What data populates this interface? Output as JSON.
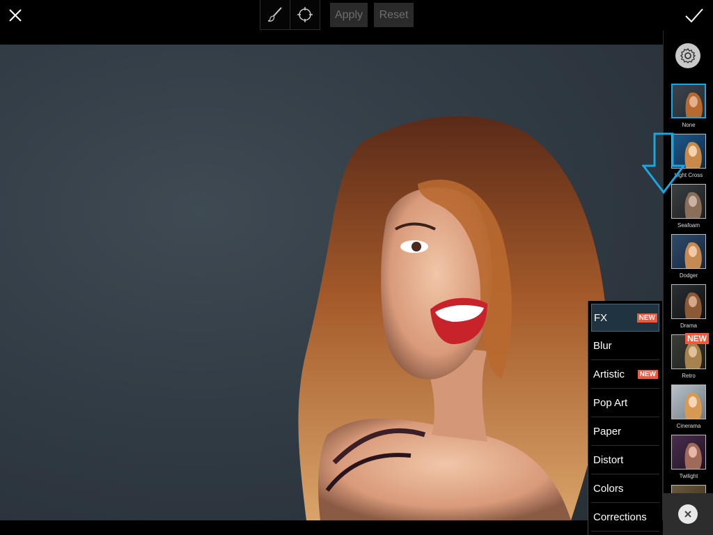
{
  "toolbar": {
    "apply_label": "Apply",
    "reset_label": "Reset",
    "icons": [
      "close-icon",
      "brush-icon",
      "lasso-icon",
      "check-icon"
    ]
  },
  "effects": [
    {
      "label": "None",
      "selected": true
    },
    {
      "label": "Light Cross",
      "selected": false
    },
    {
      "label": "Seafoam",
      "selected": false
    },
    {
      "label": "Dodger",
      "selected": false
    },
    {
      "label": "Drama",
      "selected": false
    },
    {
      "label": "Retro",
      "selected": false,
      "badge": "NEW"
    },
    {
      "label": "Cinerama",
      "selected": false
    },
    {
      "label": "Twilight",
      "selected": false
    }
  ],
  "categories": [
    {
      "label": "FX",
      "active": true,
      "badge": "NEW"
    },
    {
      "label": "Blur",
      "active": false
    },
    {
      "label": "Artistic",
      "active": false,
      "badge": "NEW"
    },
    {
      "label": "Pop Art",
      "active": false
    },
    {
      "label": "Paper",
      "active": false
    },
    {
      "label": "Distort",
      "active": false
    },
    {
      "label": "Colors",
      "active": false
    },
    {
      "label": "Corrections",
      "active": false
    }
  ],
  "colors": {
    "accent": "#1aa6e0",
    "badge": "#f05a3a"
  }
}
